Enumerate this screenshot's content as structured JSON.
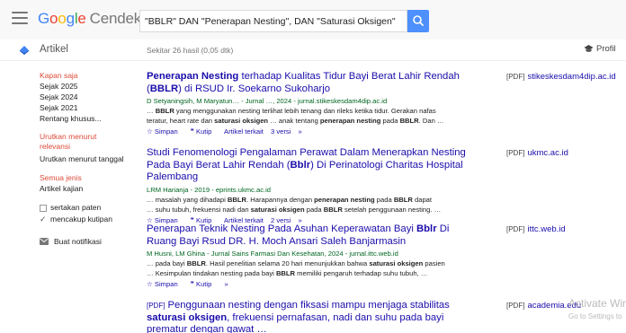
{
  "header": {
    "logo_google": "Google",
    "logo_suffix": "Cendekia",
    "search_query": "\"BBLR\" DAN \"Penerapan Nesting\", DAN \"Saturasi Oksigen\""
  },
  "subbar": {
    "section_label": "Artikel",
    "stats": "Sekitar 26 hasil (0,05 dtk)",
    "profile_label": "Profil"
  },
  "sidebar": {
    "time_header": "Kapan saja",
    "time_options": [
      "Sejak 2025",
      "Sejak 2024",
      "Sejak 2021",
      "Rentang khusus..."
    ],
    "sort_relevance": "Urutkan menurut relevansi",
    "sort_date": "Urutkan menurut tanggal",
    "type_all": "Semua jenis",
    "type_review": "Artikel kajian",
    "include_patents": "sertakan paten",
    "include_citations": "mencakup kutipan",
    "create_alert": "Buat notifikasi"
  },
  "results": [
    {
      "title_parts": [
        "Penerapan Nesting",
        " terhadap Kualitas Tidur Bayi Berat Lahir Rendah (",
        "BBLR",
        ") di RSUD Ir. Soekarno Sukoharjo"
      ],
      "meta": "D Setyaningsih, M Maryatun… - Jurnal …, 2024 - jurnal.stikeskesdam4dip.ac.id",
      "snippet1": "… BBLR yang menggunakan nesting terlihat lebih tenang dan rileks ketika tidur. Gerakan nafas",
      "snippet2": "teratur, heart rate dan saturasi oksigen … anak tentang penerapan nesting pada BBLR. Dan …",
      "save": "Simpan",
      "cite": "Kutip",
      "related": "Artikel terkait",
      "versions": "3 versi",
      "side_tag": "[PDF]",
      "side_source": "stikeskesdam4dip.ac.id"
    },
    {
      "title_parts": [
        "Studi Fenomenologi Pengalaman Perawat Dalam Menerapkan Nesting Pada Bayi Berat Lahir Rendah (",
        "Bblr",
        ") Di Perinatologi Charitas Hospital Palembang"
      ],
      "meta": "LRM Harianja - 2019 - eprints.ukmc.ac.id",
      "snippet1": "… masalah yang dihadapi BBLR. Harapannya dengan penerapan nesting pada BBLR dapat",
      "snippet2": "… suhu tubuh, frekuensi nadi dan saturasi oksigen pada BBLR setelah penggunaan nesting. …",
      "save": "Simpan",
      "cite": "Kutip",
      "related": "Artikel terkait",
      "versions": "2 versi",
      "side_tag": "[PDF]",
      "side_source": "ukmc.ac.id"
    },
    {
      "title_parts": [
        "Penerapan Teknik Nesting Pada Asuhan Keperawatan Bayi ",
        "Bblr",
        " Di Ruang Bayi Rsud DR. H. Moch Ansari Saleh Banjarmasin"
      ],
      "meta": "M Husni, LM Ghina - Jurnal Sains Farmasi Dan Kesehatan, 2024 - jurnal.ittc.web.id",
      "snippet1": "… pada bayi BBLR. Hasil penelitian selama 20 hari menunjukkan bahwa saturasi oksigen pasien",
      "snippet2": "… Kesimpulan tindakan nesting pada bayi BBLR memiliki pengaruh terhadap suhu tubuh, …",
      "save": "Simpan",
      "cite": "Kutip",
      "side_tag": "[PDF]",
      "side_source": "ittc.web.id"
    },
    {
      "title_tag": "[PDF]",
      "title_parts": [
        "Penggunaan nesting dengan fiksasi mampu menjaga stabilitas ",
        "saturasi oksigen",
        ", frekuensi pernafasan, nadi dan suhu pada bayi prematur dengan gawat …"
      ],
      "side_tag": "[PDF]",
      "side_source": "academia.edu"
    }
  ],
  "watermark": {
    "line1": "Activate Win",
    "line2": "Go to Settings to"
  },
  "colors": {
    "link": "#1a0dab",
    "meta_green": "#006621",
    "sidebar_red": "#dd4b39",
    "search_button": "#4d90fe"
  }
}
